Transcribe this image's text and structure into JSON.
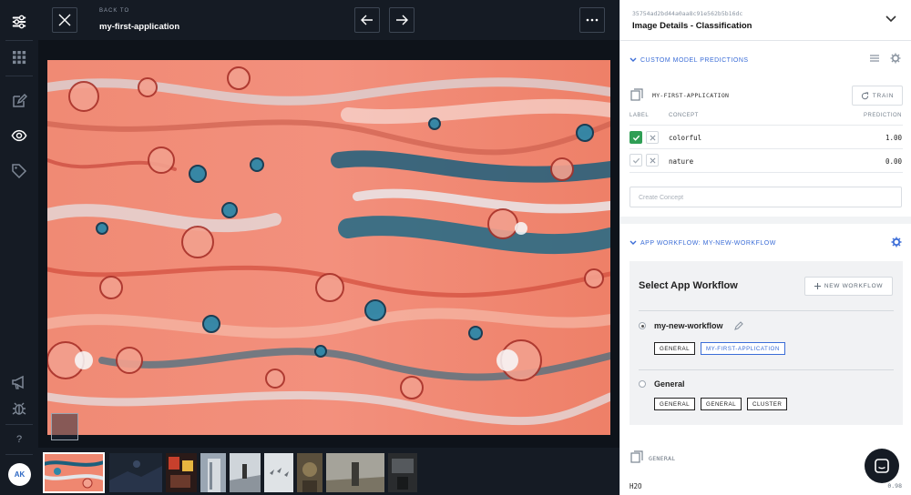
{
  "topbar": {
    "back_to": "BACK TO",
    "app_name": "my-first-application"
  },
  "rail": {
    "icons": [
      "logo-icon",
      "apps-grid-icon",
      "edit-icon",
      "eye-icon",
      "tag-icon",
      "megaphone-icon",
      "bug-icon"
    ],
    "help": "?",
    "avatar_initials": "AK"
  },
  "panel": {
    "image_id": "35754ad2bd44a0aa8c91e562b5b16dc",
    "title": "Image Details - Classification",
    "predictions": {
      "section_title": "CUSTOM MODEL PREDICTIONS",
      "model_name": "MY-FIRST-APPLICATION",
      "train_label": "TRAIN",
      "columns": {
        "label": "LABEL",
        "concept": "CONCEPT",
        "prediction": "PREDICTION"
      },
      "rows": [
        {
          "concept": "colorful",
          "prediction": "1.00",
          "labeled": true
        },
        {
          "concept": "nature",
          "prediction": "0.00",
          "labeled": false
        }
      ],
      "create_placeholder": "Create Concept"
    },
    "workflow": {
      "section_title": "APP WORKFLOW: MY-NEW-WORKFLOW",
      "select_title": "Select App Workflow",
      "new_workflow_label": "NEW WORKFLOW",
      "items": [
        {
          "name": "my-new-workflow",
          "selected": true,
          "chips": [
            "GENERAL",
            "MY-FIRST-APPLICATION"
          ]
        },
        {
          "name": "General",
          "selected": false,
          "chips": [
            "GENERAL",
            "GENERAL",
            "CLUSTER"
          ]
        }
      ]
    },
    "general": {
      "label": "GENERAL",
      "first_concept": "H2O",
      "first_value": "0.98"
    }
  },
  "colors": {
    "dark_bg": "#151b24",
    "accent": "#3b6dd7",
    "check_green": "#2f9e55"
  }
}
